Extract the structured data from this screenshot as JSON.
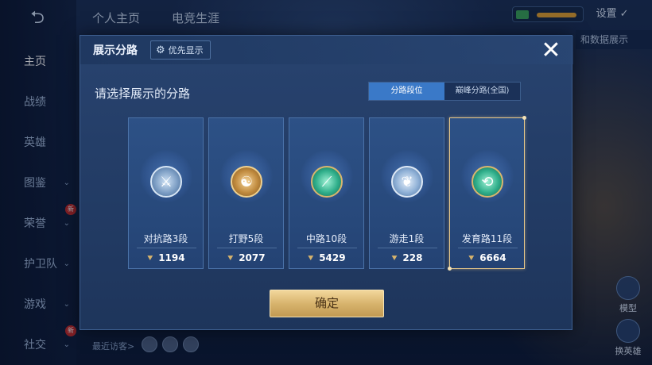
{
  "topbar": {
    "tabs": [
      "个人主页",
      "电竞生涯"
    ],
    "settings_label": "设置",
    "data_display_hint": "和数据展示"
  },
  "sidebar": {
    "items": [
      {
        "label": "主页",
        "active": true
      },
      {
        "label": "战绩"
      },
      {
        "label": "英雄"
      },
      {
        "label": "图鉴",
        "has_chevron": true
      },
      {
        "label": "荣誉",
        "has_chevron": true,
        "badge": "新"
      },
      {
        "label": "护卫队",
        "has_chevron": true
      },
      {
        "label": "游戏",
        "has_chevron": true
      },
      {
        "label": "社交",
        "has_chevron": true,
        "badge": "新"
      }
    ]
  },
  "footer": {
    "recent_visitors_label": "最近访客>"
  },
  "right_buttons": {
    "model_label": "模型",
    "switch_hero_label": "换英雄"
  },
  "dialog": {
    "title": "展示分路",
    "priority_label": "优先显示",
    "subtitle": "请选择展示的分路",
    "segments": [
      {
        "label": "分路段位",
        "active": true
      },
      {
        "label": "巅峰分路(全国)",
        "active": false
      }
    ],
    "lanes": [
      {
        "rank": "对抗路3段",
        "score": "1194",
        "emblem": "silver",
        "icon": "sword-shield-icon",
        "selected": false
      },
      {
        "rank": "打野5段",
        "score": "2077",
        "emblem": "gold",
        "icon": "dragon-icon",
        "selected": false
      },
      {
        "rank": "中路10段",
        "score": "5429",
        "emblem": "green",
        "icon": "staff-icon",
        "selected": false
      },
      {
        "rank": "游走1段",
        "score": "228",
        "emblem": "blue-silver",
        "icon": "wings-icon",
        "selected": false
      },
      {
        "rank": "发育路11段",
        "score": "6664",
        "emblem": "green",
        "icon": "bow-icon",
        "selected": true
      }
    ],
    "confirm_label": "确定"
  },
  "colors": {
    "accent_gold": "#e7c88a",
    "segment_active": "#3a79c8",
    "dialog_bg": "#223b64"
  }
}
